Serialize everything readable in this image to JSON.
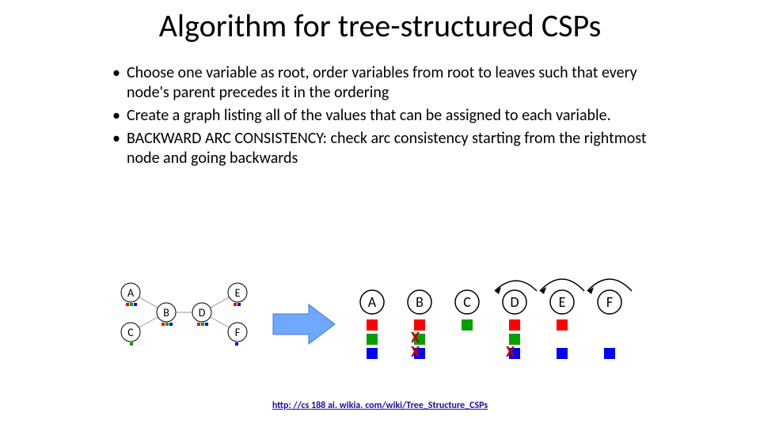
{
  "title": "Algorithm for tree-structured CSPs",
  "bullets": [
    "Choose one variable as root, order variables from root to leaves such that every node's parent precedes it in the ordering",
    "Create a graph listing all of the values that can be assigned to each variable.",
    "BACKWARD ARC CONSISTENCY: check arc consistency starting from the rightmost node and going backwards"
  ],
  "link": "http: //cs 188 ai. wikia. com/wiki/Tree_Structure_CSPs",
  "nodes_left": [
    "A",
    "B",
    "C",
    "D",
    "E",
    "F"
  ],
  "nodes_right": [
    "A",
    "B",
    "C",
    "D",
    "E",
    "F"
  ],
  "x": "X",
  "colors": {
    "r": "#ff0000",
    "g": "#00a000",
    "b": "#0000ff"
  }
}
